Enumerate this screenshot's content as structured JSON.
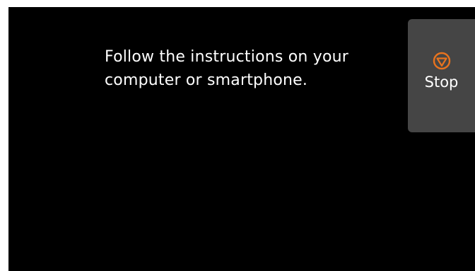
{
  "screen": {
    "message": "Follow the instructions on your\ncomputer or smartphone."
  },
  "stop_button": {
    "label": "Stop",
    "icon": "stop-icon",
    "icon_color": "#e8731e",
    "background_color": "#454545"
  },
  "colors": {
    "screen_background": "#000000",
    "text": "#ffffff"
  }
}
